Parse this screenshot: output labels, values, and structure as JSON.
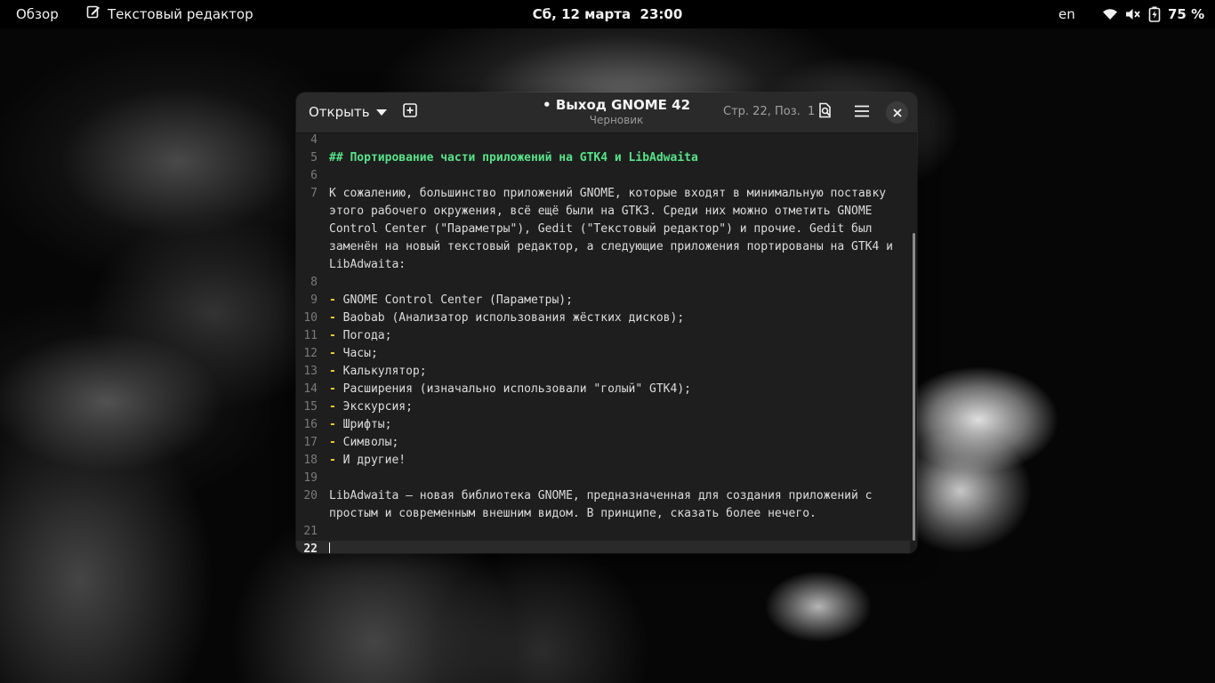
{
  "topbar": {
    "activities": "Обзор",
    "app_name": "Текстовый редактор",
    "app_icon": "text-editor-icon",
    "clock": "Сб, 12 марта  23:00",
    "keyboard_layout": "en",
    "status_icons": [
      "wifi-icon",
      "volume-muted-icon",
      "battery-icon"
    ],
    "battery": "75 %"
  },
  "window": {
    "open_label": "Открыть",
    "new_tab_icon": "new-tab-icon",
    "title": "Выход GNOME 42",
    "modified_marker": "•",
    "subtitle": "Черновик",
    "position": "Стр. 22, Поз.  1",
    "buttons": [
      "search-document-icon",
      "hamburger-menu-icon",
      "close-icon"
    ]
  },
  "editor": {
    "current_line": 22,
    "lines": [
      {
        "num": "4",
        "text": ""
      },
      {
        "num": "5",
        "text": "## Портирование части приложений на GTK4 и LibAdwaita"
      },
      {
        "num": "6",
        "text": ""
      },
      {
        "num": "7",
        "text": "К сожалению, большинство приложений GNOME, которые входят в минимальную поставку этого рабочего окружения, всё ещё были на GTK3. Среди них можно отметить GNOME Control Center (\"Параметры\"), Gedit (\"Текстовый редактор\") и прочие. Gedit был заменён на новый текстовый редактор, а следующие приложения портированы на GTK4 и LibAdwaita:"
      },
      {
        "num": "8",
        "text": ""
      },
      {
        "num": "9",
        "bullet": "-",
        "text": " GNOME Control Center (Параметры);"
      },
      {
        "num": "10",
        "bullet": "-",
        "text": " Baobab (Анализатор использования жёстких дисков);"
      },
      {
        "num": "11",
        "bullet": "-",
        "text": " Погода;"
      },
      {
        "num": "12",
        "bullet": "-",
        "text": " Часы;"
      },
      {
        "num": "13",
        "bullet": "-",
        "text": " Калькулятор;"
      },
      {
        "num": "14",
        "bullet": "-",
        "text": " Расширения (изначально использовали \"голый\" GTK4);"
      },
      {
        "num": "15",
        "bullet": "-",
        "text": " Экскурсия;"
      },
      {
        "num": "16",
        "bullet": "-",
        "text": " Шрифты;"
      },
      {
        "num": "17",
        "bullet": "-",
        "text": " Символы;"
      },
      {
        "num": "18",
        "bullet": "-",
        "text": " И другие!"
      },
      {
        "num": "19",
        "text": ""
      },
      {
        "num": "20",
        "text": "LibAdwaita – новая библиотека GNOME, предназначенная для создания приложений с простым и современным внешним видом. В принципе, сказать более нечего."
      },
      {
        "num": "21",
        "text": ""
      },
      {
        "num": "22",
        "text": ""
      }
    ]
  }
}
